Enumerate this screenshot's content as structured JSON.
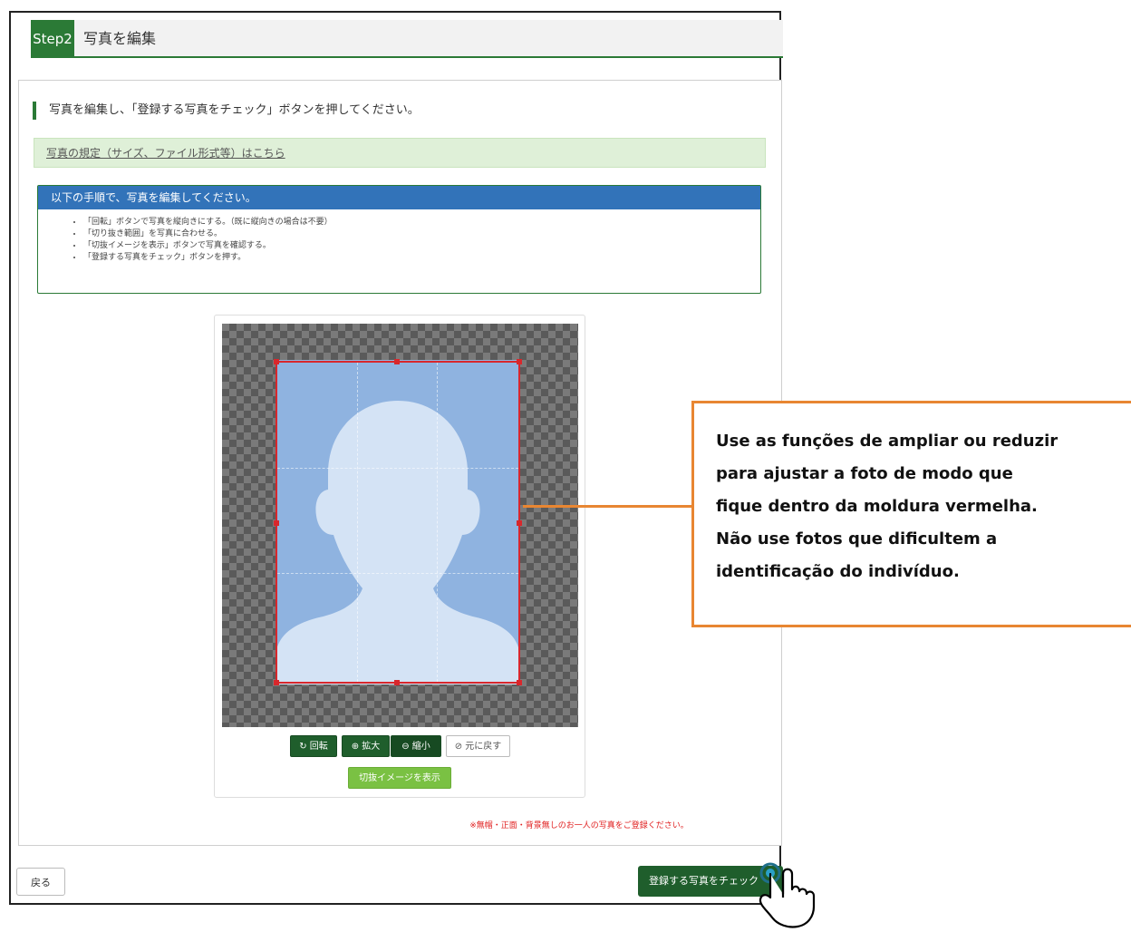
{
  "step": {
    "badge": "Step2",
    "title": "写真を編集"
  },
  "instruction": "写真を編集し、「登録する写真をチェック」ボタンを押してください。",
  "notice_link": "写真の規定（サイズ、ファイル形式等）はこちら",
  "howto": {
    "heading": "以下の手順で、写真を編集してください。",
    "items": [
      "「回転」ボタンで写真を縦向きにする。（既に縦向きの場合は不要）",
      "「切り抜き範囲」を写真に合わせる。",
      "「切抜イメージを表示」ボタンで写真を確認する。",
      "「登録する写真をチェック」ボタンを押す。"
    ]
  },
  "buttons": {
    "rotate": "回転",
    "zoom_in": "拡大",
    "zoom_out": "縮小",
    "reset": "元に戻す",
    "preview": "切抜イメージを表示",
    "back": "戻る",
    "check": "登録する写真をチェック"
  },
  "warning": "※無帽・正面・背景無しのお一人の写真をご登録ください。",
  "callout": {
    "lines": [
      "Use as funções de ampliar ou reduzir",
      "para ajustar a foto de modo que",
      "fique dentro da moldura vermelha.",
      "Não use fotos que dificultem a",
      "identificação do indivíduo."
    ]
  },
  "icons": {
    "rotate": "rotate-icon",
    "zoom_in": "zoom-in-icon",
    "zoom_out": "zoom-out-icon",
    "reset": "reset-icon",
    "cursor": "pointer-hand-icon"
  },
  "colors": {
    "primary_green": "#2b7a36",
    "dark_green": "#1f5e2c",
    "light_green": "#7ac143",
    "panel_blue": "#3273b9",
    "crop_red": "#d8272c",
    "callout_orange": "#e88632"
  }
}
